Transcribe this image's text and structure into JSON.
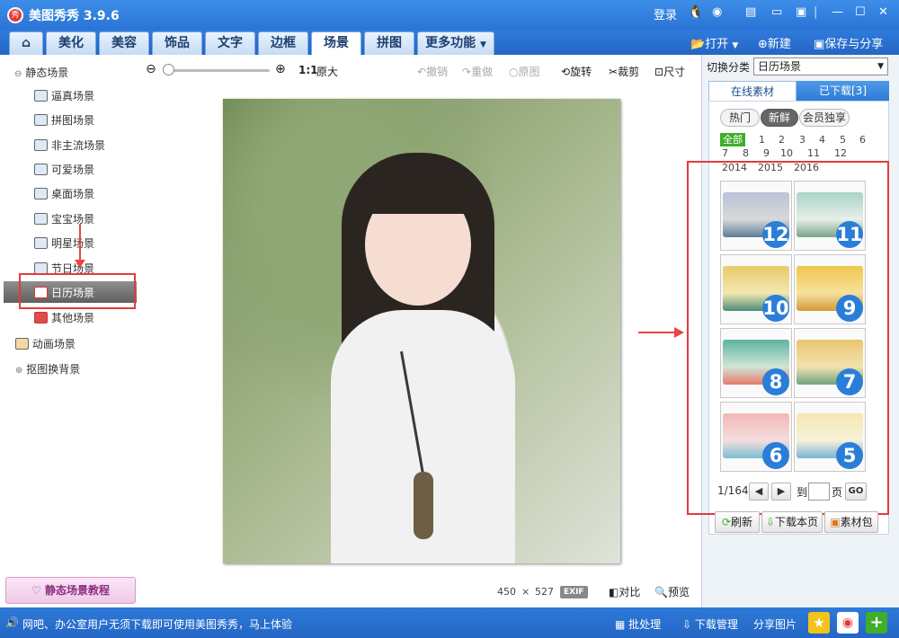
{
  "app": {
    "title": "美图秀秀 3.9.6",
    "logo_text": "秀"
  },
  "titlebar": {
    "login": "登录"
  },
  "tabs": [
    {
      "label": "美化"
    },
    {
      "label": "美容"
    },
    {
      "label": "饰品"
    },
    {
      "label": "文字"
    },
    {
      "label": "边框"
    },
    {
      "label": "场景",
      "active": true
    },
    {
      "label": "拼图"
    },
    {
      "label": "更多功能"
    }
  ],
  "top_actions": {
    "open": "打开",
    "new": "新建",
    "save_share": "保存与分享"
  },
  "sidebar": {
    "static_header": "静态场景",
    "items": [
      {
        "label": "逼真场景"
      },
      {
        "label": "拼图场景"
      },
      {
        "label": "非主流场景"
      },
      {
        "label": "可爱场景"
      },
      {
        "label": "桌面场景"
      },
      {
        "label": "宝宝场景"
      },
      {
        "label": "明星场景"
      },
      {
        "label": "节日场景"
      },
      {
        "label": "日历场景",
        "selected": true
      },
      {
        "label": "其他场景"
      }
    ],
    "animated": "动画场景",
    "cutout": "抠图换背景",
    "tutorial": "静态场景教程"
  },
  "toolbar": {
    "ratio": "1:1",
    "original_size": "原大",
    "undo": "撤销",
    "redo": "重做",
    "original": "原图",
    "rotate": "旋转",
    "crop": "裁剪",
    "size": "尺寸"
  },
  "image_info": {
    "width": "450",
    "times": "×",
    "height": "527",
    "exif": "EXIF",
    "compare": "对比",
    "preview": "预览"
  },
  "right_panel": {
    "switch_label": "切换分类",
    "category": "日历场景",
    "tab_online": "在线素材",
    "tab_downloaded": "已下载[3]",
    "chips": [
      "热门",
      "新鲜",
      "会员独享"
    ],
    "filter_all": "全部",
    "months_row1": [
      "1",
      "2",
      "3",
      "4",
      "5",
      "6"
    ],
    "months_row2": [
      "7",
      "8",
      "9",
      "10",
      "11",
      "12"
    ],
    "years": [
      "2014",
      "2015",
      "2016"
    ],
    "thumbs": [
      "12",
      "11",
      "10",
      "9",
      "8",
      "7",
      "6",
      "5"
    ],
    "page_info": "1/164",
    "goto_label": "到",
    "page_label": "页",
    "go": "GO",
    "refresh": "刷新",
    "download_page": "下载本页",
    "material_pack": "素材包"
  },
  "status": {
    "message": "网吧、办公室用户无须下载即可使用美图秀秀，马上体验",
    "batch": "批处理",
    "download_mgr": "下载管理",
    "share_pic": "分享图片"
  },
  "colors": {
    "accent": "#2a74d6",
    "badge": "#2b7ed8",
    "highlight": "#e23b3b",
    "all_filter": "#3fae2a"
  }
}
